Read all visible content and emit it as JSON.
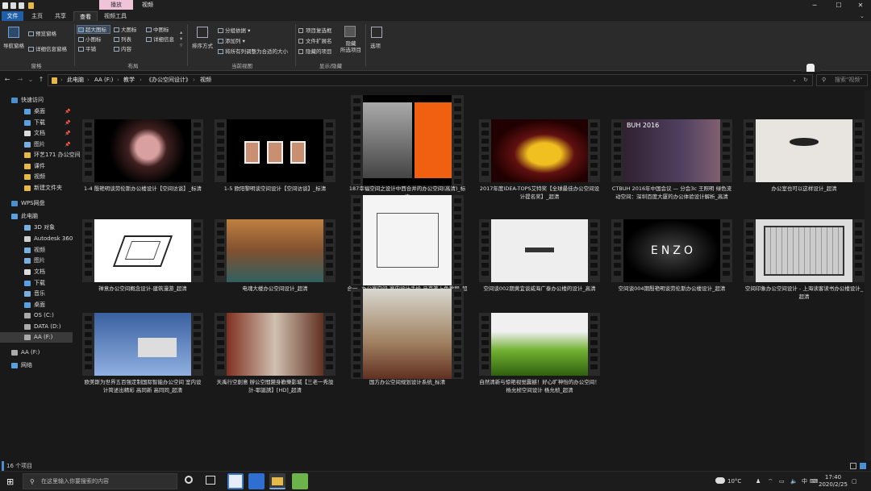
{
  "titlebar": {
    "context_tab": "播放",
    "context_title": "视频",
    "btn_min": "─",
    "btn_max": "☐",
    "btn_close": "✕"
  },
  "ribbon_tabs": [
    "文件",
    "主页",
    "共享",
    "查看",
    "视频工具"
  ],
  "ribbon": {
    "nav_pane": "导航窗格",
    "preview_pane": "预览窗格",
    "details_pane": "详细信息窗格",
    "layout_items": [
      "超大图标",
      "大图标",
      "中图标",
      "小图标",
      "列表",
      "详细信息",
      "平铺",
      "内容"
    ],
    "sort_by": "排序方式",
    "group_by": "分组依据",
    "add_columns": "添加列",
    "size_all_columns": "将所有列调整为合适的大小",
    "item_checkboxes": "项目复选框",
    "file_extensions": "文件扩展名",
    "hidden_items": "隐藏的项目",
    "hide_selected": "隐藏\n所选项目",
    "options": "选项",
    "groups": [
      "窗格",
      "布局",
      "当前视图",
      "显示/隐藏"
    ]
  },
  "address": {
    "crumbs": [
      "此电脑",
      "AA (F:)",
      "教学",
      "《办公空间设计》",
      "视频"
    ],
    "search_placeholder": "搜索\"视频\""
  },
  "sidebar": {
    "items": [
      {
        "label": "快速访问",
        "icon": "star-icon",
        "pin": false
      },
      {
        "label": "桌面",
        "icon": "desktop-icon",
        "pin": true
      },
      {
        "label": "下载",
        "icon": "download-icon",
        "pin": true
      },
      {
        "label": "文档",
        "icon": "document-icon",
        "pin": true
      },
      {
        "label": "图片",
        "icon": "picture-icon",
        "pin": true
      },
      {
        "label": "环艺171   办公空间",
        "icon": "folder-icon",
        "pin": false
      },
      {
        "label": "课件",
        "icon": "folder-icon",
        "pin": false
      },
      {
        "label": "视频",
        "icon": "folder-icon",
        "pin": false
      },
      {
        "label": "新建文件夹",
        "icon": "folder-icon",
        "pin": false
      },
      {
        "label": "WPS网盘",
        "icon": "cloud-icon",
        "pin": false
      },
      {
        "label": "此电脑",
        "icon": "computer-icon",
        "pin": false
      },
      {
        "label": "3D 对象",
        "icon": "cube-icon",
        "pin": false
      },
      {
        "label": "Autodesk 360",
        "icon": "autodesk-icon",
        "pin": false
      },
      {
        "label": "视频",
        "icon": "video-icon",
        "pin": false
      },
      {
        "label": "图片",
        "icon": "picture-icon",
        "pin": false
      },
      {
        "label": "文档",
        "icon": "document-icon",
        "pin": false
      },
      {
        "label": "下载",
        "icon": "download-icon",
        "pin": false
      },
      {
        "label": "音乐",
        "icon": "music-icon",
        "pin": false
      },
      {
        "label": "桌面",
        "icon": "desktop-icon",
        "pin": false
      },
      {
        "label": "OS (C:)",
        "icon": "drive-icon",
        "pin": false
      },
      {
        "label": "DATA (D:)",
        "icon": "drive-icon",
        "pin": false
      },
      {
        "label": "AA (F:)",
        "icon": "drive-icon",
        "pin": false
      },
      {
        "label": "AA (F:)",
        "icon": "drive-icon",
        "pin": false
      },
      {
        "label": "网络",
        "icon": "network-icon",
        "pin": false
      }
    ]
  },
  "files": [
    {
      "name": "1-4 殷艳明谈劳伦斯办公楼设计【空间访谈】_标清",
      "thumb": "woman-portrait"
    },
    {
      "name": "1-5 欧阳黎明谈空间设计【空间访谈】_标清",
      "thumb": "three-frames"
    },
    {
      "name": "187幸福空间之设计中西合并的办公空间(高清)_标清",
      "thumb": "man-orange"
    },
    {
      "name": "2017年度IDEA-TOPS艾特奖【全球最佳办公空间设计提名奖】_超清",
      "thumb": "yellow-sculpture"
    },
    {
      "name": "CTBUH 2016年中国会议 — 分会3c 王照明 绿色流动空间：深圳百度大厦的办公体验设计解析_高清",
      "thumb": "conference",
      "overlay": "BUH 2016"
    },
    {
      "name": "办公室也可以这样设计_超清",
      "thumb": "pendant-lamp"
    },
    {
      "name": "禅意办公空间概念设计-建筑漫游_超清",
      "thumb": "sketch"
    },
    {
      "name": "电魂大楼办公空间设计_超清",
      "thumb": "colorful-interior"
    },
    {
      "name": "合一--办公室空间-室内设计手绘-马克笔上色教程_超清",
      "thumb": "line-drawing"
    },
    {
      "name": "空间谈002期黄宜谈威海广泰办公楼的设计_高清",
      "thumb": "white-logo"
    },
    {
      "name": "空间谈004期殷艳明谈劳伦斯办公楼设计_超清",
      "thumb": "enzo",
      "overlay": "ENZO"
    },
    {
      "name": "空间印象办公空间设计 - 上海读客读书办公楼设计_超清",
      "thumb": "floor-plan"
    },
    {
      "name": "欧美斯为世界五百强定制国际智能办公空间 室内设计简述出精彩 高同新 高同同_超清",
      "thumb": "blue-sky"
    },
    {
      "name": "天禹行空創意 辦公空間變身歡樂影城【三老一秀設計-耶誕誘】[HD]_超清",
      "thumb": "glass-store"
    },
    {
      "name": "国方办公空间规划设计系统_标清",
      "thumb": "office-desk"
    },
    {
      "name": "自然清新与惊艳视觉震撼！好心旷神怡的办公空间！ 杨允桢空间设计 杨允桢_超清",
      "thumb": "green-grass"
    }
  ],
  "status": {
    "count": "16 个项目"
  },
  "taskbar": {
    "search_placeholder": "在这里输入你要搜索的内容",
    "weather": "10°C",
    "ime": "中",
    "time": "17:40",
    "date": "2020/2/25"
  },
  "colors": {
    "background": "#191919",
    "ribbon": "#2b2b2b",
    "file_tab": "#1e5fa8",
    "context_tab": "#efc3d8",
    "folder": "#e5b84c"
  }
}
